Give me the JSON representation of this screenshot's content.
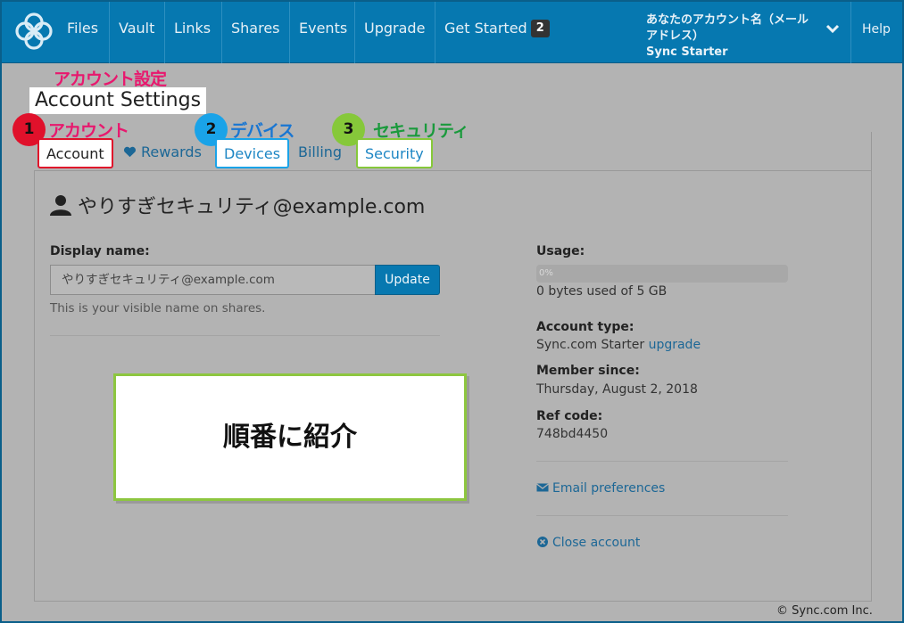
{
  "nav": {
    "items": [
      "Files",
      "Vault",
      "Links",
      "Shares",
      "Events",
      "Upgrade",
      "Get Started"
    ],
    "get_started_badge": "2",
    "account_name": "あなたのアカウント名（メールアドレス）",
    "account_plan": "Sync Starter",
    "help": "Help"
  },
  "annotations": {
    "title_jp": "アカウント設定",
    "tab1_num": "1",
    "tab1_jp": "アカウント",
    "tab2_num": "2",
    "tab2_jp": "デバイス",
    "tab3_num": "3",
    "tab3_jp": "セキュリティ",
    "callout": "順番に紹介",
    "colors": {
      "red": "#e0112b",
      "blue": "#1aa3e8",
      "green": "#86c83a",
      "pink": "#e8186e"
    }
  },
  "page": {
    "title": "Account Settings",
    "tabs": [
      "Account",
      "Rewards",
      "Devices",
      "Billing",
      "Security"
    ]
  },
  "profile": {
    "email_heading": "やりすぎセキュリティ@example.com",
    "display_name_label": "Display name:",
    "display_name_value": "やりすぎセキュリティ@example.com",
    "update_button": "Update",
    "display_name_help": "This is your visible name on shares."
  },
  "usage": {
    "label": "Usage:",
    "percent_text": "0%",
    "percent_value": 0,
    "detail": "0 bytes used of 5 GB"
  },
  "account_info": {
    "type_label": "Account type:",
    "type_value": "Sync.com Starter",
    "upgrade_link": "upgrade",
    "member_label": "Member since:",
    "member_value": "Thursday, August 2, 2018",
    "ref_label": "Ref code:",
    "ref_value": "748bd4450"
  },
  "links": {
    "email_prefs": "Email preferences",
    "close_account": "Close account"
  },
  "footer": "© Sync.com Inc."
}
